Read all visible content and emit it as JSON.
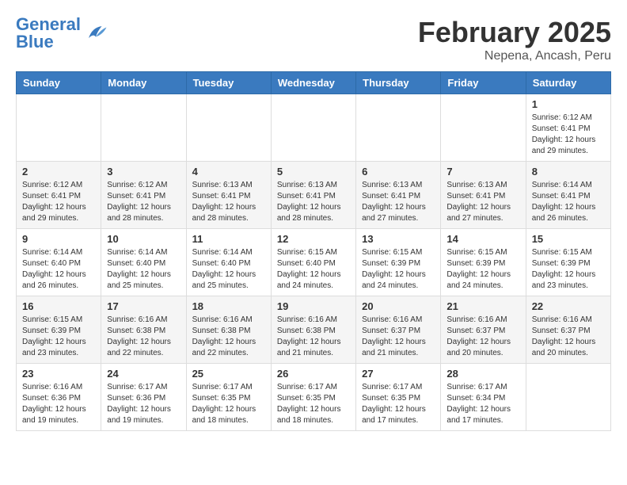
{
  "logo": {
    "text_general": "General",
    "text_blue": "Blue"
  },
  "header": {
    "month_title": "February 2025",
    "subtitle": "Nepena, Ancash, Peru"
  },
  "days_of_week": [
    "Sunday",
    "Monday",
    "Tuesday",
    "Wednesday",
    "Thursday",
    "Friday",
    "Saturday"
  ],
  "weeks": [
    [
      {
        "day": "",
        "info": ""
      },
      {
        "day": "",
        "info": ""
      },
      {
        "day": "",
        "info": ""
      },
      {
        "day": "",
        "info": ""
      },
      {
        "day": "",
        "info": ""
      },
      {
        "day": "",
        "info": ""
      },
      {
        "day": "1",
        "info": "Sunrise: 6:12 AM\nSunset: 6:41 PM\nDaylight: 12 hours\nand 29 minutes."
      }
    ],
    [
      {
        "day": "2",
        "info": "Sunrise: 6:12 AM\nSunset: 6:41 PM\nDaylight: 12 hours\nand 29 minutes."
      },
      {
        "day": "3",
        "info": "Sunrise: 6:12 AM\nSunset: 6:41 PM\nDaylight: 12 hours\nand 28 minutes."
      },
      {
        "day": "4",
        "info": "Sunrise: 6:13 AM\nSunset: 6:41 PM\nDaylight: 12 hours\nand 28 minutes."
      },
      {
        "day": "5",
        "info": "Sunrise: 6:13 AM\nSunset: 6:41 PM\nDaylight: 12 hours\nand 28 minutes."
      },
      {
        "day": "6",
        "info": "Sunrise: 6:13 AM\nSunset: 6:41 PM\nDaylight: 12 hours\nand 27 minutes."
      },
      {
        "day": "7",
        "info": "Sunrise: 6:13 AM\nSunset: 6:41 PM\nDaylight: 12 hours\nand 27 minutes."
      },
      {
        "day": "8",
        "info": "Sunrise: 6:14 AM\nSunset: 6:41 PM\nDaylight: 12 hours\nand 26 minutes."
      }
    ],
    [
      {
        "day": "9",
        "info": "Sunrise: 6:14 AM\nSunset: 6:40 PM\nDaylight: 12 hours\nand 26 minutes."
      },
      {
        "day": "10",
        "info": "Sunrise: 6:14 AM\nSunset: 6:40 PM\nDaylight: 12 hours\nand 25 minutes."
      },
      {
        "day": "11",
        "info": "Sunrise: 6:14 AM\nSunset: 6:40 PM\nDaylight: 12 hours\nand 25 minutes."
      },
      {
        "day": "12",
        "info": "Sunrise: 6:15 AM\nSunset: 6:40 PM\nDaylight: 12 hours\nand 24 minutes."
      },
      {
        "day": "13",
        "info": "Sunrise: 6:15 AM\nSunset: 6:39 PM\nDaylight: 12 hours\nand 24 minutes."
      },
      {
        "day": "14",
        "info": "Sunrise: 6:15 AM\nSunset: 6:39 PM\nDaylight: 12 hours\nand 24 minutes."
      },
      {
        "day": "15",
        "info": "Sunrise: 6:15 AM\nSunset: 6:39 PM\nDaylight: 12 hours\nand 23 minutes."
      }
    ],
    [
      {
        "day": "16",
        "info": "Sunrise: 6:15 AM\nSunset: 6:39 PM\nDaylight: 12 hours\nand 23 minutes."
      },
      {
        "day": "17",
        "info": "Sunrise: 6:16 AM\nSunset: 6:38 PM\nDaylight: 12 hours\nand 22 minutes."
      },
      {
        "day": "18",
        "info": "Sunrise: 6:16 AM\nSunset: 6:38 PM\nDaylight: 12 hours\nand 22 minutes."
      },
      {
        "day": "19",
        "info": "Sunrise: 6:16 AM\nSunset: 6:38 PM\nDaylight: 12 hours\nand 21 minutes."
      },
      {
        "day": "20",
        "info": "Sunrise: 6:16 AM\nSunset: 6:37 PM\nDaylight: 12 hours\nand 21 minutes."
      },
      {
        "day": "21",
        "info": "Sunrise: 6:16 AM\nSunset: 6:37 PM\nDaylight: 12 hours\nand 20 minutes."
      },
      {
        "day": "22",
        "info": "Sunrise: 6:16 AM\nSunset: 6:37 PM\nDaylight: 12 hours\nand 20 minutes."
      }
    ],
    [
      {
        "day": "23",
        "info": "Sunrise: 6:16 AM\nSunset: 6:36 PM\nDaylight: 12 hours\nand 19 minutes."
      },
      {
        "day": "24",
        "info": "Sunrise: 6:17 AM\nSunset: 6:36 PM\nDaylight: 12 hours\nand 19 minutes."
      },
      {
        "day": "25",
        "info": "Sunrise: 6:17 AM\nSunset: 6:35 PM\nDaylight: 12 hours\nand 18 minutes."
      },
      {
        "day": "26",
        "info": "Sunrise: 6:17 AM\nSunset: 6:35 PM\nDaylight: 12 hours\nand 18 minutes."
      },
      {
        "day": "27",
        "info": "Sunrise: 6:17 AM\nSunset: 6:35 PM\nDaylight: 12 hours\nand 17 minutes."
      },
      {
        "day": "28",
        "info": "Sunrise: 6:17 AM\nSunset: 6:34 PM\nDaylight: 12 hours\nand 17 minutes."
      },
      {
        "day": "",
        "info": ""
      }
    ]
  ]
}
